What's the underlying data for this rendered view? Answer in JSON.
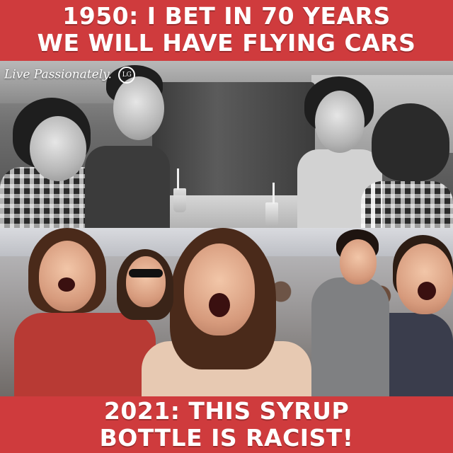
{
  "meme": {
    "top_caption": {
      "line1": "1950: I BET IN 70 YEARS",
      "line2": "WE WILL HAVE FLYING CARS"
    },
    "bottom_caption": {
      "line1": "2021: THIS SYRUP",
      "line2": "BOTTLE IS RACIST!"
    },
    "watermark": {
      "text": "Live Passionately.",
      "logo_text": "LG"
    },
    "colors": {
      "background": "#cf3b3d",
      "caption_text": "#ffffff"
    }
  }
}
